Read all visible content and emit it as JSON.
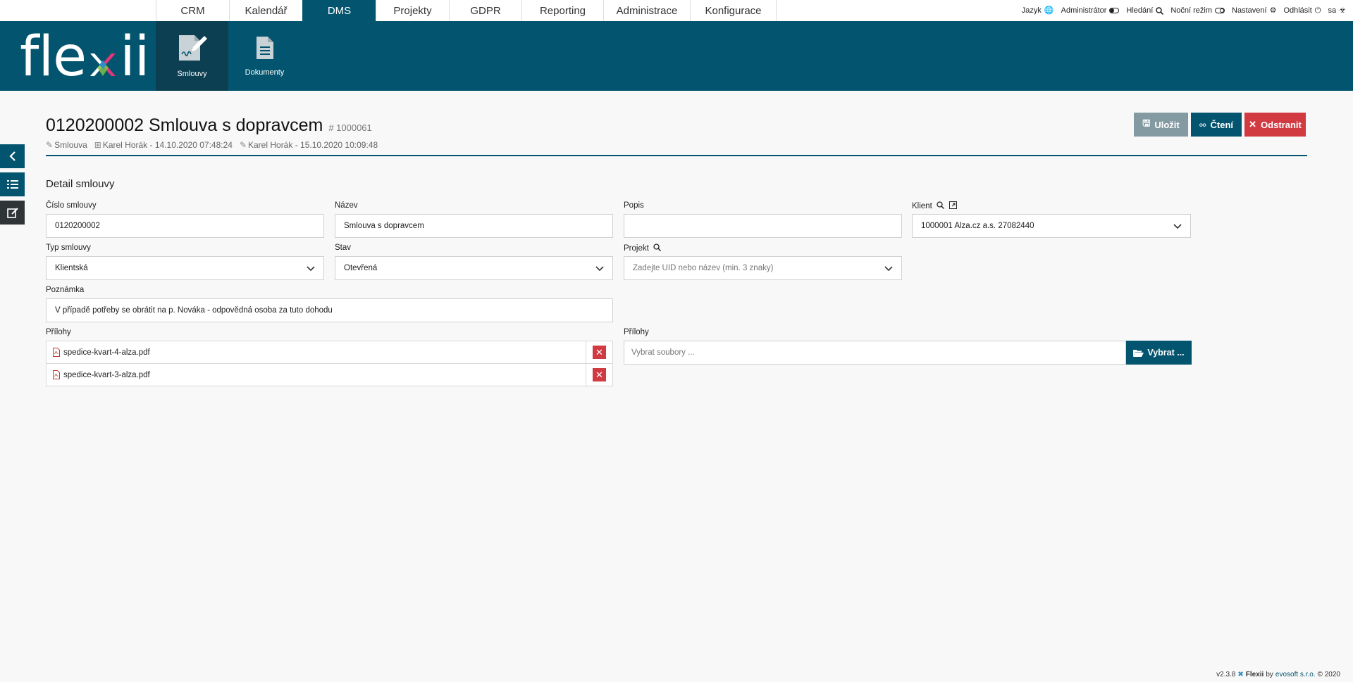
{
  "nav": {
    "tabs": [
      {
        "label": "CRM"
      },
      {
        "label": "Kalendář"
      },
      {
        "label": "DMS"
      },
      {
        "label": "Projekty"
      },
      {
        "label": "GDPR"
      },
      {
        "label": "Reporting"
      },
      {
        "label": "Administrace"
      },
      {
        "label": "Konfigurace"
      }
    ],
    "active_tab": "DMS",
    "right": {
      "language": "Jazyk",
      "admin": "Administrátor",
      "search": "Hledání",
      "night": "Noční režim",
      "settings": "Nastavení",
      "logout": "Odhlásit",
      "user": "sa"
    }
  },
  "header": {
    "logo": "flexii",
    "submenu": [
      {
        "label": "Smlouvy"
      },
      {
        "label": "Dokumenty"
      }
    ]
  },
  "page": {
    "title": "0120200002 Smlouva s dopravcem",
    "doc_id": "# 1000061",
    "meta_type": "Smlouva",
    "meta_created": "Karel Horák - 14.10.2020 07:48:24",
    "meta_modified": "Karel Horák - 15.10.2020 10:09:48",
    "actions": {
      "save": "Uložit",
      "read": "Čtení",
      "delete": "Odstranit"
    },
    "section_title": "Detail smlouvy"
  },
  "form": {
    "cislo": {
      "label": "Číslo smlouvy",
      "value": "0120200002"
    },
    "nazev": {
      "label": "Název",
      "value": "Smlouva s dopravcem"
    },
    "popis": {
      "label": "Popis",
      "value": ""
    },
    "klient": {
      "label": "Klient",
      "value": "1000001  Alza.cz a.s. 27082440"
    },
    "typ": {
      "label": "Typ smlouvy",
      "value": "Klientská"
    },
    "stav": {
      "label": "Stav",
      "value": "Otevřená"
    },
    "projekt": {
      "label": "Projekt",
      "placeholder": "Zadejte UID nebo název (min. 3 znaky)"
    },
    "poznamka": {
      "label": "Poznámka",
      "value": "V případě potřeby se obrátit na p. Nováka - odpovědná osoba za tuto dohodu"
    },
    "prilohy_label": "Přílohy",
    "attachments": [
      {
        "name": "spedice-kvart-4-alza.pdf"
      },
      {
        "name": "spedice-kvart-3-alza.pdf"
      }
    ],
    "upload": {
      "label": "Přílohy",
      "placeholder": "Vybrat soubory ...",
      "button": "Vybrat ..."
    }
  },
  "footer": {
    "version": "v2.3.8",
    "brand": "Flexii",
    "by": "by",
    "company": "evosoft s.r.o.",
    "copyright": "© 2020"
  },
  "colors": {
    "primary": "#03546e",
    "danger": "#d13a41",
    "muted": "#849aa2"
  }
}
